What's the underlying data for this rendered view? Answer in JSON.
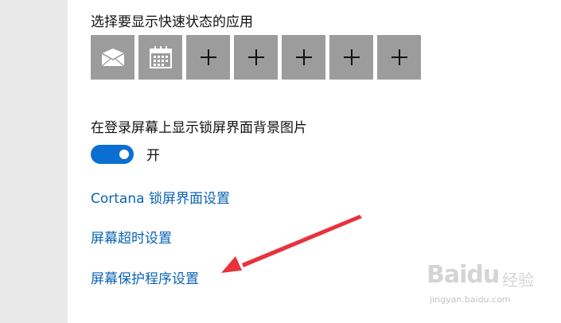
{
  "quick_status": {
    "title": "选择要显示快速状态的应用",
    "tiles": [
      {
        "icon": "mail-icon"
      },
      {
        "icon": "calendar-icon"
      },
      {
        "icon": "plus-icon",
        "label": "+"
      },
      {
        "icon": "plus-icon",
        "label": "+"
      },
      {
        "icon": "plus-icon",
        "label": "+"
      },
      {
        "icon": "plus-icon",
        "label": "+"
      },
      {
        "icon": "plus-icon",
        "label": "+"
      }
    ]
  },
  "lock_background": {
    "title": "在登录屏幕上显示锁屏界面背景图片",
    "toggle_state_label": "开",
    "toggle_on": true
  },
  "links": {
    "cortana": "Cortana 锁屏界面设置",
    "timeout": "屏幕超时设置",
    "screensaver": "屏幕保护程序设置"
  },
  "watermark": {
    "brand": "Baidu",
    "sub": "经验",
    "url": "jingyan.baidu.com"
  },
  "colors": {
    "accent": "#0a6fd0",
    "link": "#0a64b4",
    "tile": "#9c9c9c",
    "annotation_arrow": "#e8323c"
  }
}
